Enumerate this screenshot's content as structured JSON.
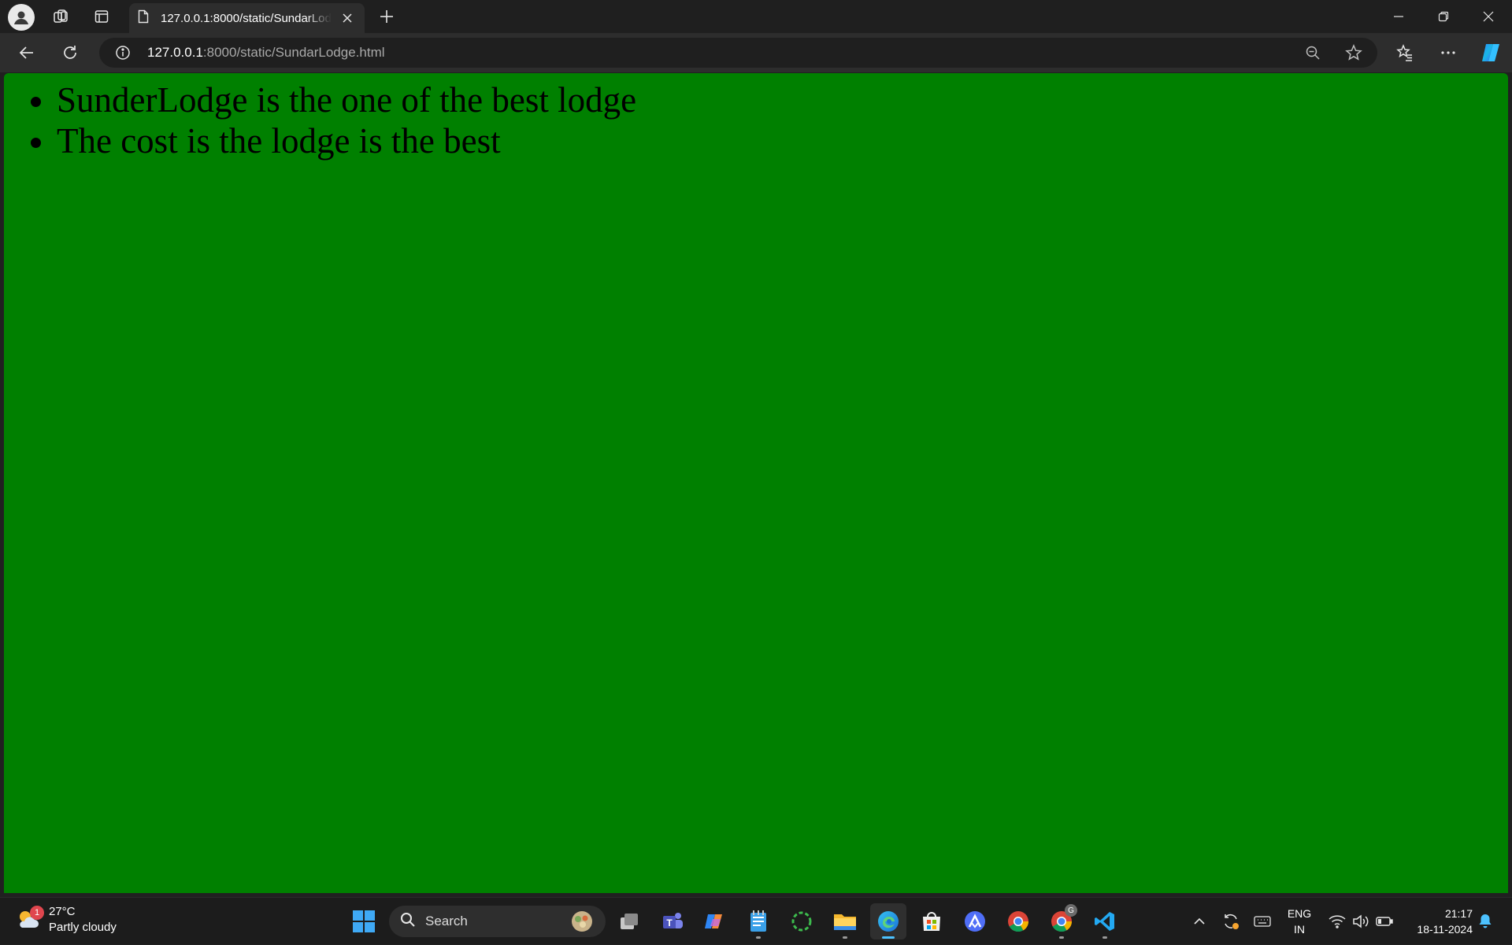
{
  "browser": {
    "tab_title": "127.0.0.1:8000/static/SundarLodge.html",
    "url_host": "127.0.0.1",
    "url_rest": ":8000/static/SundarLodge.html"
  },
  "page": {
    "background_color": "#008000",
    "items": [
      "SunderLodge is the one of the best lodge",
      "The cost is the lodge is the best"
    ]
  },
  "taskbar": {
    "weather": {
      "temp": "27°C",
      "condition": "Partly cloudy",
      "badge": "1"
    },
    "search_label": "Search",
    "chrome_badge": "G",
    "lang_line1": "ENG",
    "lang_line2": "IN",
    "time": "21:17",
    "date": "18-11-2024"
  }
}
